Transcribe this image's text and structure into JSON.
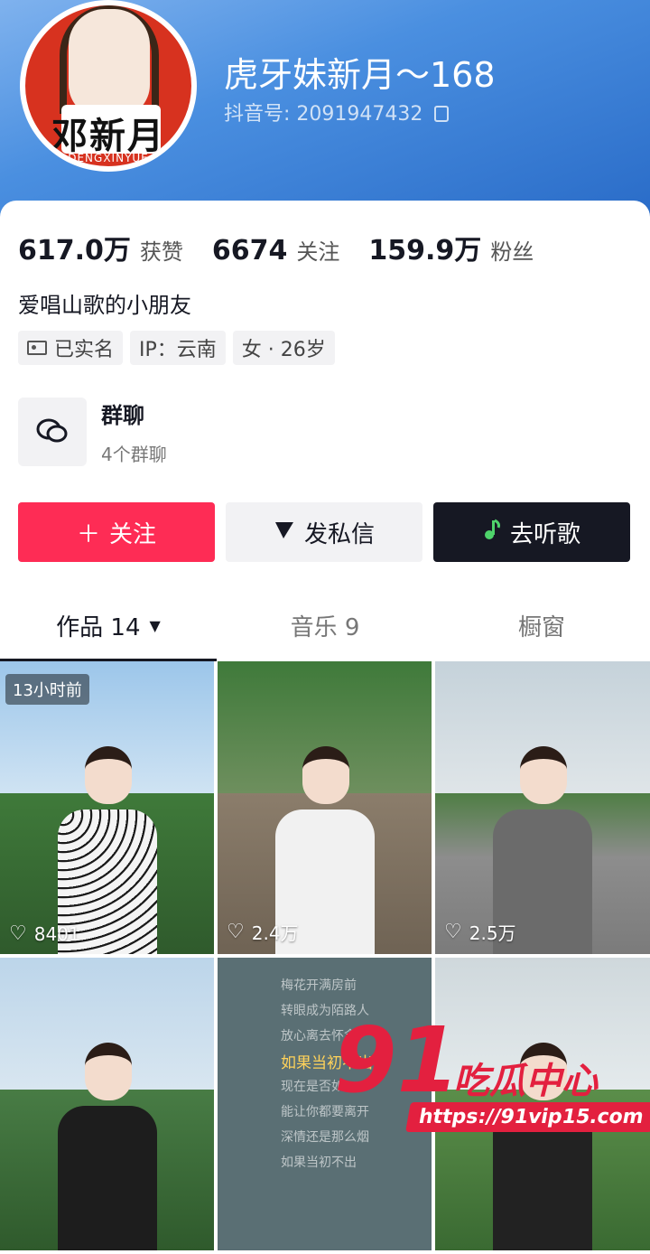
{
  "header": {
    "avatar_name": "邓新月",
    "avatar_sub": "DENGXINYUE",
    "nickname": "虎牙妹新月～168",
    "douyin_id_label": "抖音号:",
    "douyin_id": "2091947432"
  },
  "stats": [
    {
      "value": "617.0万",
      "label": "获赞"
    },
    {
      "value": "6674",
      "label": "关注"
    },
    {
      "value": "159.9万",
      "label": "粉丝"
    }
  ],
  "bio": "爱唱山歌的小朋友",
  "tags": [
    "已实名",
    "IP：云南",
    "女 · 26岁"
  ],
  "group_chat": {
    "title": "群聊",
    "subtitle": "4个群聊"
  },
  "actions": {
    "follow": "关注",
    "message": "发私信",
    "music": "去听歌"
  },
  "tabs": [
    {
      "label": "作品 14",
      "active": true
    },
    {
      "label": "音乐 9",
      "active": false
    },
    {
      "label": "橱窗",
      "active": false
    }
  ],
  "videos": [
    {
      "likes": "8401",
      "badge": "13小时前"
    },
    {
      "likes": "2.4万"
    },
    {
      "likes": "2.5万"
    },
    {
      "likes": ""
    },
    {
      "likes": ""
    },
    {
      "likes": ""
    }
  ],
  "lyrics": [
    "梅花开满房前",
    "转眼成为陌路人",
    "放心离去怀念",
    "如果当初不出",
    "现在是否如",
    "能让你都要离开",
    "深情还是那么烟",
    "如果当初不出"
  ],
  "watermark": {
    "brand": "91",
    "name": "吃瓜中心",
    "url": "https://91vip15.com"
  },
  "colors": {
    "accent": "#fe2c55",
    "dark_button": "#161823"
  }
}
